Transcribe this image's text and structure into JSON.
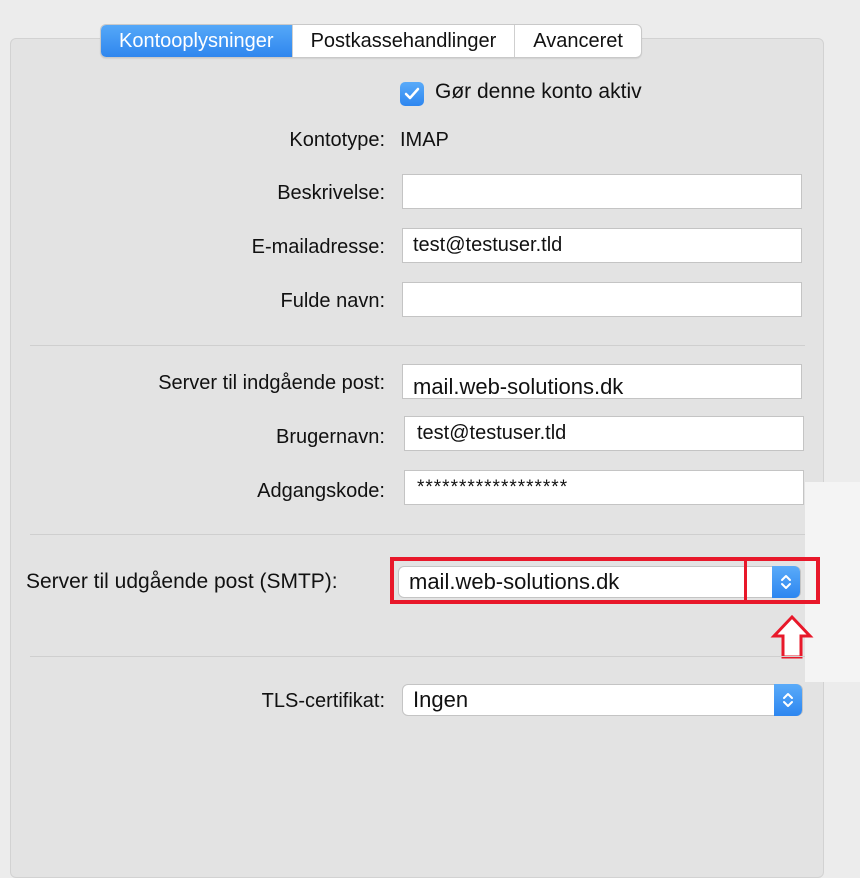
{
  "tabs": [
    {
      "label": "Kontooplysninger",
      "active": true
    },
    {
      "label": "Postkassehandlinger",
      "active": false
    },
    {
      "label": "Avanceret",
      "active": false
    }
  ],
  "account_active": {
    "label": "Gør denne konto aktiv",
    "checked": true
  },
  "account_type": {
    "label": "Kontotype:",
    "value": "IMAP"
  },
  "description": {
    "label": "Beskrivelse:",
    "value": ""
  },
  "email": {
    "label": "E-mailadresse:",
    "value": "test@testuser.tld"
  },
  "full_name": {
    "label": "Fulde navn:",
    "value": ""
  },
  "incoming_server": {
    "label": "Server til indgående post:",
    "value": "mail.web-solutions.dk"
  },
  "username": {
    "label": "Brugernavn:",
    "value": "test@testuser.tld"
  },
  "password": {
    "label": "Adgangskode:",
    "value": "******************"
  },
  "outgoing_server": {
    "label": "Server til udgående post (SMTP):",
    "value": "mail.web-solutions.dk"
  },
  "tls_certificate": {
    "label": "TLS-certifikat:",
    "value": "Ingen"
  },
  "colors": {
    "accent": "#2f86ee",
    "highlight": "#e8182a",
    "arrow_outline": "#e8182a"
  }
}
